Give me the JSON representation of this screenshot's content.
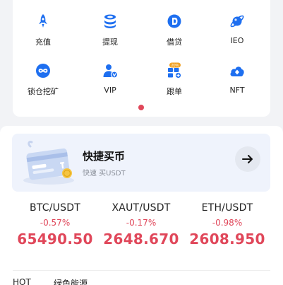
{
  "menu": {
    "items": [
      {
        "label": "充值",
        "icon": "rocket-icon"
      },
      {
        "label": "提现",
        "icon": "coin-stack-icon"
      },
      {
        "label": "借贷",
        "icon": "dollar-coin-icon"
      },
      {
        "label": "IEO",
        "icon": "planet-icon"
      },
      {
        "label": "锁仓挖矿",
        "icon": "infinity-badge-icon"
      },
      {
        "label": "VIP",
        "icon": "vip-user-icon"
      },
      {
        "label": "跟单",
        "icon": "copy-trade-icon",
        "badge": "20%"
      },
      {
        "label": "NFT",
        "icon": "nft-cloud-icon"
      }
    ],
    "accent": "#1e6ff0"
  },
  "quick_buy": {
    "title": "快捷买币",
    "subtitle": "快速 买USDT",
    "arrow_icon": "arrow-right-icon"
  },
  "tickers": [
    {
      "pair": "BTC/USDT",
      "change": "-0.57%",
      "price": "65490.50"
    },
    {
      "pair": "XAUT/USDT",
      "change": "-0.17%",
      "price": "2648.670"
    },
    {
      "pair": "ETH/USDT",
      "change": "-0.98%",
      "price": "2608.950"
    }
  ],
  "tabs": [
    {
      "label": "HOT"
    },
    {
      "label": "绿色能源"
    }
  ],
  "colors": {
    "down": "#e0475a",
    "page_bg": "#f2f3f6",
    "quick_bg": "#eff3fc"
  }
}
